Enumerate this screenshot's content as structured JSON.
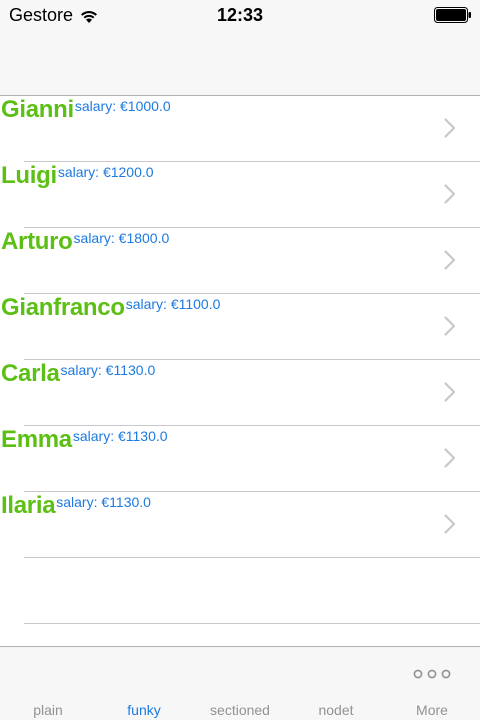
{
  "status_bar": {
    "carrier": "Gestore",
    "time": "12:33"
  },
  "rows": [
    {
      "name": "Gianni",
      "salary": "salary: €1000.0"
    },
    {
      "name": "Luigi",
      "salary": "salary: €1200.0"
    },
    {
      "name": "Arturo",
      "salary": "salary: €1800.0"
    },
    {
      "name": "Gianfranco",
      "salary": "salary: €1100.0"
    },
    {
      "name": "Carla",
      "salary": "salary: €1130.0"
    },
    {
      "name": "Emma",
      "salary": "salary: €1130.0"
    },
    {
      "name": "Ilaria",
      "salary": "salary: €1130.0"
    }
  ],
  "tabs": [
    {
      "label": "plain"
    },
    {
      "label": "funky",
      "selected": true
    },
    {
      "label": "sectioned"
    },
    {
      "label": "nodet"
    },
    {
      "label": "More"
    }
  ],
  "colors": {
    "name": "#5cbf14",
    "salary": "#1c7ae0",
    "tab_selected": "#1c7ae0",
    "tab_inactive": "#929292"
  }
}
